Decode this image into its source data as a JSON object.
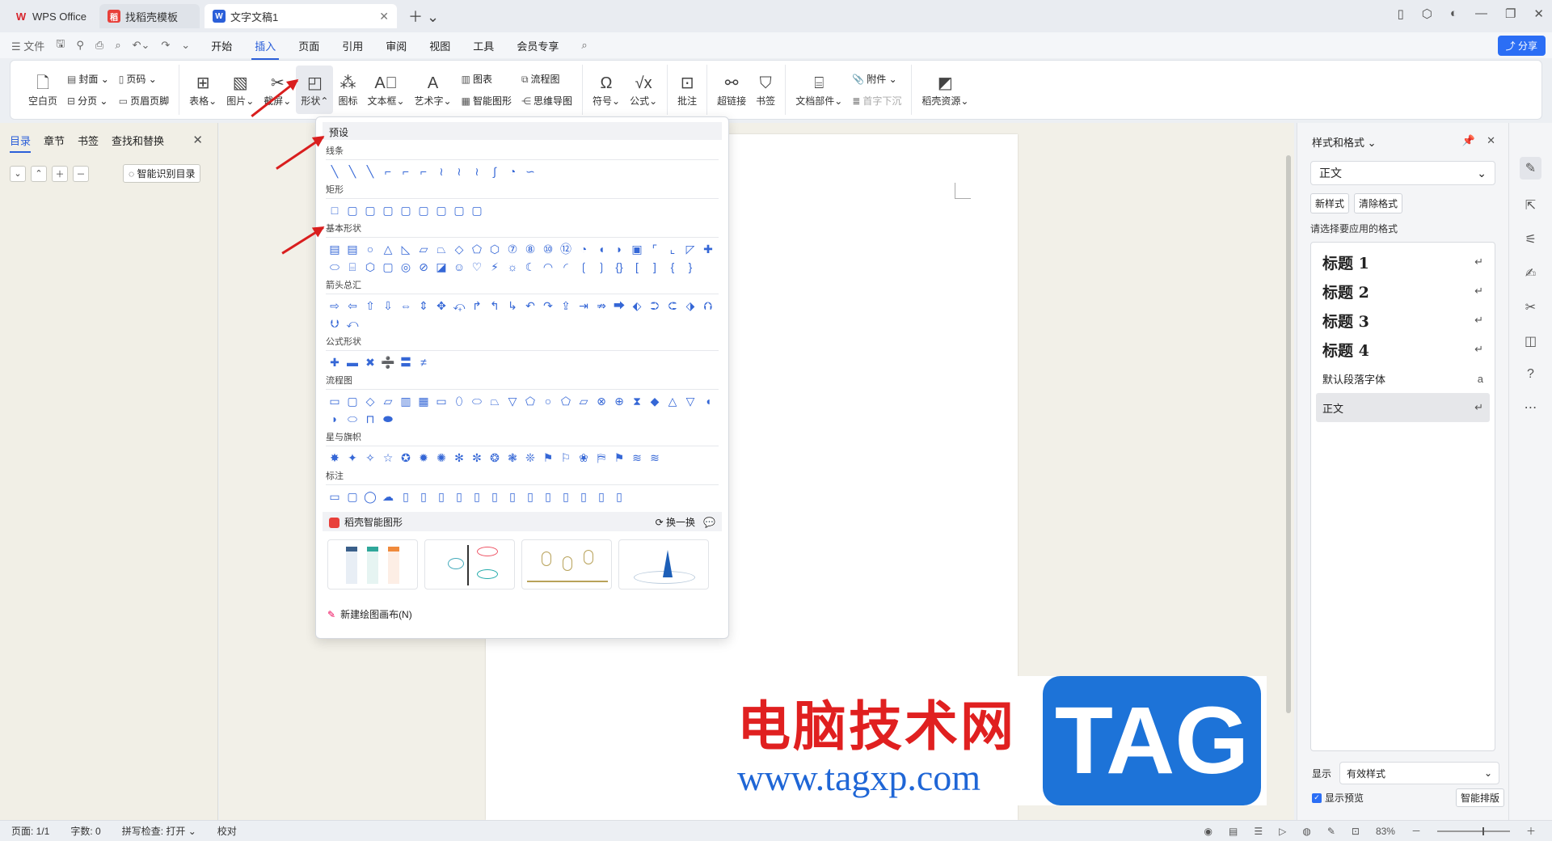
{
  "tabs": [
    {
      "label": "WPS Office",
      "icon": "wps-logo-icon"
    },
    {
      "label": "找稻壳模板",
      "icon": "docer-icon"
    },
    {
      "label": "文字文稿1",
      "icon": "writer-icon"
    }
  ],
  "menu": {
    "file": "文件",
    "items": [
      "开始",
      "插入",
      "页面",
      "引用",
      "审阅",
      "视图",
      "工具",
      "会员专享"
    ],
    "active": "插入",
    "share": "分享"
  },
  "ribbon": {
    "blank_page": "空白页",
    "cover": "封面",
    "page_break": "分页",
    "page_number": "页码",
    "header_footer": "页眉页脚",
    "table": "表格",
    "picture": "图片",
    "screenshot": "截屏",
    "shapes": "形状",
    "icons": "图标",
    "textbox": "文本框",
    "wordart": "艺术字",
    "chart": "图表",
    "smart_graphic": "智能图形",
    "flowchart": "流程图",
    "mindmap": "思维导图",
    "symbol": "符号",
    "formula": "公式",
    "comment": "批注",
    "hyperlink": "超链接",
    "bookmark": "书签",
    "doc_parts": "文档部件",
    "attachment": "附件",
    "drop_cap": "首字下沉",
    "docer_resources": "稻壳资源"
  },
  "leftpanel": {
    "tabs": [
      "目录",
      "章节",
      "书签",
      "查找和替换"
    ],
    "smart_toc": "智能识别目录"
  },
  "shapes_dropdown": {
    "preset": "预设",
    "categories": [
      {
        "title": "线条",
        "shapes": [
          "╲",
          "╲",
          "╲",
          "⌐",
          "⌐",
          "⌐",
          "≀",
          "≀",
          "≀",
          "∫",
          "◔",
          "∽"
        ]
      },
      {
        "title": "矩形",
        "shapes": [
          "□",
          "▢",
          "▢",
          "▢",
          "▢",
          "▢",
          "▢",
          "▢",
          "▢"
        ]
      },
      {
        "title": "基本形状",
        "shapes": [
          "▤",
          "▤",
          "○",
          "△",
          "◺",
          "▱",
          "⏢",
          "◇",
          "⬠",
          "⬡",
          "⑦",
          "⑧",
          "⑩",
          "⑫",
          "◔",
          "◖",
          "◗",
          "▣",
          "⌜",
          "⌞",
          "◸",
          "✚",
          "⬭",
          "⌸",
          "⬡",
          "▢",
          "◎",
          "⊘",
          "◪",
          "☺",
          "♡",
          "⚡",
          "☼",
          "☾",
          "◠",
          "◜",
          "❲",
          "❳",
          "{}",
          "[",
          "]",
          "{",
          "}"
        ]
      },
      {
        "title": "箭头总汇",
        "shapes": [
          "⇨",
          "⇦",
          "⇧",
          "⇩",
          "⇔",
          "⇕",
          "✥",
          "⤽",
          "↱",
          "↰",
          "↳",
          "↶",
          "↷",
          "⇪",
          "⇥",
          "⇏",
          "⮕",
          "⬖",
          "⮊",
          "⮈",
          "⬗",
          "⮉",
          "⮋",
          "⤺"
        ]
      },
      {
        "title": "公式形状",
        "shapes": [
          "✚",
          "▬",
          "✖",
          "➗",
          "〓",
          "≠"
        ]
      },
      {
        "title": "流程图",
        "shapes": [
          "▭",
          "▢",
          "◇",
          "▱",
          "▥",
          "▦",
          "▭",
          "⬯",
          "⬭",
          "⏢",
          "▽",
          "⬠",
          "○",
          "⬠",
          "⏥",
          "⊗",
          "⊕",
          "⧗",
          "◆",
          "△",
          "▽",
          "◖",
          "◗",
          "⬭",
          "⊓",
          "⬬"
        ]
      },
      {
        "title": "星与旗帜",
        "shapes": [
          "✸",
          "✦",
          "✧",
          "☆",
          "✪",
          "✹",
          "✺",
          "✻",
          "✼",
          "❂",
          "❃",
          "❊",
          "⚑",
          "⚐",
          "❀",
          "⛿",
          "⚑",
          "≋",
          "≋"
        ]
      },
      {
        "title": "标注",
        "shapes": [
          "▭",
          "▢",
          "◯",
          "☁",
          "▯",
          "▯",
          "▯",
          "▯",
          "▯",
          "▯",
          "▯",
          "▯",
          "▯",
          "▯",
          "▯",
          "▯",
          "▯"
        ]
      }
    ],
    "ai_title": "稻壳智能图形",
    "swap": "换一换",
    "new_canvas": "新建绘图画布(N)"
  },
  "rightpanel": {
    "title": "样式和格式",
    "current_style": "正文",
    "new_style": "新样式",
    "clear_format": "清除格式",
    "hint": "请选择要应用的格式",
    "styles": [
      {
        "name": "标题  1",
        "key": "↵",
        "big": true
      },
      {
        "name": "标题  2",
        "key": "↵",
        "big": true
      },
      {
        "name": "标题  3",
        "key": "↵",
        "big": true
      },
      {
        "name": "标题  4",
        "key": "↵",
        "big": true
      },
      {
        "name": "默认段落字体",
        "key": "a",
        "big": false
      },
      {
        "name": "正文",
        "key": "↵",
        "big": false,
        "selected": true
      }
    ],
    "display_label": "显示",
    "display_value": "有效样式",
    "show_preview": "显示预览",
    "smart_layout": "智能排版"
  },
  "statusbar": {
    "page": "页面: 1/1",
    "words": "字数: 0",
    "spell": "拼写检查: 打开",
    "proof": "校对",
    "zoom": "83%"
  },
  "watermark": {
    "cn": "电脑技术网",
    "url": "www.tagxp.com",
    "tag": "TAG"
  }
}
